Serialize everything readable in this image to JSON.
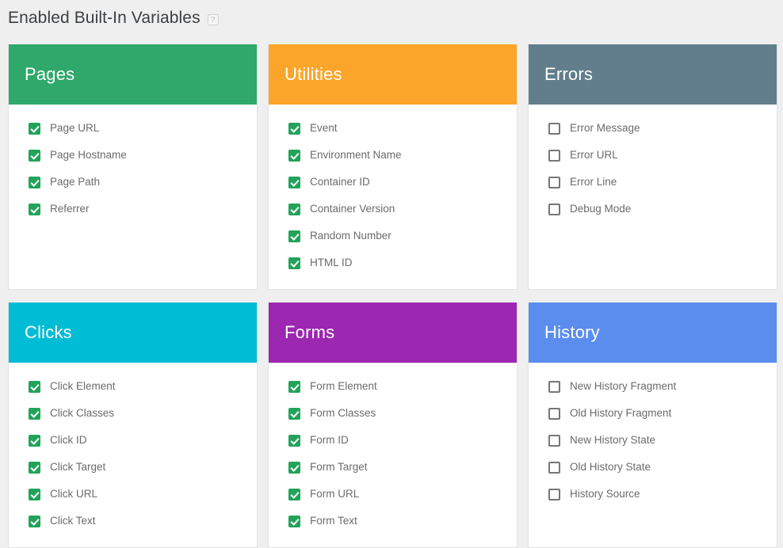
{
  "header": {
    "title": "Enabled Built-In Variables",
    "help_icon": "help-question-icon",
    "help_glyph": "?"
  },
  "theme": {
    "page_background": "#efefef",
    "card_background": "#ffffff",
    "card_border": "#e2e2e2",
    "checkbox_on": "#22a35a",
    "checkbox_off_border": "#777777",
    "label_text": "#6b6b6b",
    "title_text": "#3c4043"
  },
  "cards": [
    {
      "title": "Pages",
      "header_color": "#2fa96b",
      "variables": [
        {
          "label": "Page URL",
          "checked": true
        },
        {
          "label": "Page Hostname",
          "checked": true
        },
        {
          "label": "Page Path",
          "checked": true
        },
        {
          "label": "Referrer",
          "checked": true
        }
      ]
    },
    {
      "title": "Utilities",
      "header_color": "#fba62a",
      "variables": [
        {
          "label": "Event",
          "checked": true
        },
        {
          "label": "Environment Name",
          "checked": true
        },
        {
          "label": "Container ID",
          "checked": true
        },
        {
          "label": "Container Version",
          "checked": true
        },
        {
          "label": "Random Number",
          "checked": true
        },
        {
          "label": "HTML ID",
          "checked": true
        }
      ]
    },
    {
      "title": "Errors",
      "header_color": "#627e8c",
      "variables": [
        {
          "label": "Error Message",
          "checked": false
        },
        {
          "label": "Error URL",
          "checked": false
        },
        {
          "label": "Error Line",
          "checked": false
        },
        {
          "label": "Debug Mode",
          "checked": false
        }
      ]
    },
    {
      "title": "Clicks",
      "header_color": "#00bcd4",
      "variables": [
        {
          "label": "Click Element",
          "checked": true
        },
        {
          "label": "Click Classes",
          "checked": true
        },
        {
          "label": "Click ID",
          "checked": true
        },
        {
          "label": "Click Target",
          "checked": true
        },
        {
          "label": "Click URL",
          "checked": true
        },
        {
          "label": "Click Text",
          "checked": true
        }
      ]
    },
    {
      "title": "Forms",
      "header_color": "#9c27b0",
      "variables": [
        {
          "label": "Form Element",
          "checked": true
        },
        {
          "label": "Form Classes",
          "checked": true
        },
        {
          "label": "Form ID",
          "checked": true
        },
        {
          "label": "Form Target",
          "checked": true
        },
        {
          "label": "Form URL",
          "checked": true
        },
        {
          "label": "Form Text",
          "checked": true
        }
      ]
    },
    {
      "title": "History",
      "header_color": "#5b8def",
      "variables": [
        {
          "label": "New History Fragment",
          "checked": false
        },
        {
          "label": "Old History Fragment",
          "checked": false
        },
        {
          "label": "New History State",
          "checked": false
        },
        {
          "label": "Old History State",
          "checked": false
        },
        {
          "label": "History Source",
          "checked": false
        }
      ]
    }
  ]
}
